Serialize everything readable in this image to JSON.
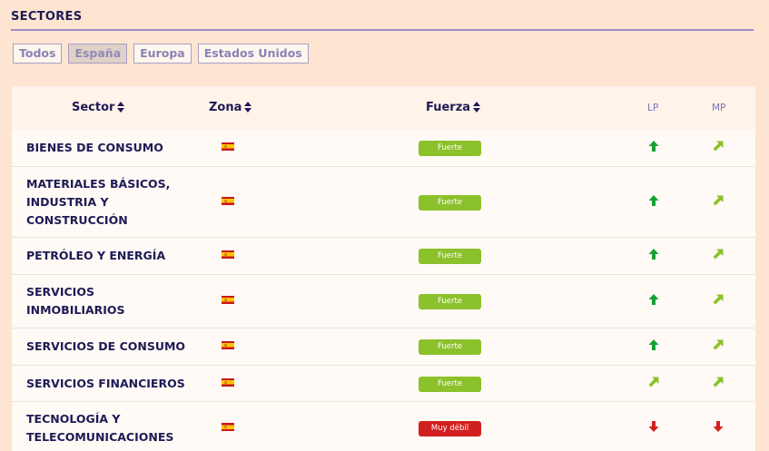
{
  "header": {
    "title": "SECTORES"
  },
  "filters": [
    {
      "label": "Todos",
      "active": false
    },
    {
      "label": "España",
      "active": true
    },
    {
      "label": "Europa",
      "active": false
    },
    {
      "label": "Estados Unidos",
      "active": false
    }
  ],
  "table": {
    "columns": {
      "sector": "Sector",
      "zona": "Zona",
      "fuerza": "Fuerza",
      "lp": "LP",
      "mp": "MP"
    },
    "rows": [
      {
        "sector": [
          "BIENES DE CONSUMO"
        ],
        "zona": "spain-flag-icon",
        "fuerza": "Fuerte",
        "lp": "up",
        "mp": "up-right"
      },
      {
        "sector": [
          "MATERIALES BÁSICOS,",
          "INDUSTRIA Y",
          "CONSTRUCCIÓN"
        ],
        "zona": "spain-flag-icon",
        "fuerza": "Fuerte",
        "lp": "up",
        "mp": "up-right"
      },
      {
        "sector": [
          "PETRÓLEO Y ENERGÍA"
        ],
        "zona": "spain-flag-icon",
        "fuerza": "Fuerte",
        "lp": "up",
        "mp": "up-right"
      },
      {
        "sector": [
          "SERVICIOS",
          "INMOBILIARIOS"
        ],
        "zona": "spain-flag-icon",
        "fuerza": "Fuerte",
        "lp": "up",
        "mp": "up-right"
      },
      {
        "sector": [
          "SERVICIOS DE CONSUMO"
        ],
        "zona": "spain-flag-icon",
        "fuerza": "Fuerte",
        "lp": "up",
        "mp": "up-right"
      },
      {
        "sector": [
          "SERVICIOS FINANCIEROS"
        ],
        "zona": "spain-flag-icon",
        "fuerza": "Fuerte",
        "lp": "up-right",
        "mp": "up-right"
      },
      {
        "sector": [
          "TECNOLOGÍA Y",
          "TELECOMUNICACIONES"
        ],
        "zona": "spain-flag-icon",
        "fuerza": "Muy débil",
        "lp": "down",
        "mp": "down"
      }
    ]
  },
  "colors": {
    "fuerte": "#8bc12a",
    "muy_debil": "#d11f1f",
    "arrow_up": "#17a233",
    "arrow_up_right": "#8bc12a",
    "arrow_down": "#d11f1f"
  }
}
